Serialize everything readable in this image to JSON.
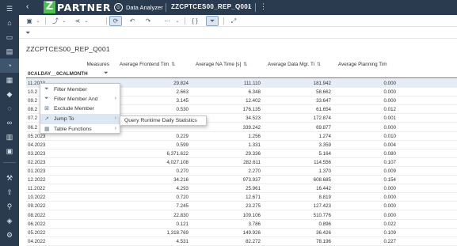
{
  "shell": {
    "logo_letter": "Z",
    "logo_text": "PARTNER",
    "app_name": "Data Analyzer",
    "document_name": "ZZCPTCES00_REP_Q001"
  },
  "query_title": "ZZCPTCES00_REP_Q001",
  "table": {
    "measures_label": "Measures",
    "dimension_label": "0CALDAY__0CALMONTH",
    "columns": [
      "Average Frontend Tim",
      "Average NA Time [s]",
      "Average Data Mgr. Ti",
      "Average Planning Tim"
    ],
    "rows": [
      {
        "label": "11.2023",
        "values": [
          "29.824",
          "111.110",
          "181.942",
          "0.000"
        ]
      },
      {
        "label": "10.2",
        "values": [
          "2.663",
          "6.348",
          "58.662",
          "0.000"
        ]
      },
      {
        "label": "09.2",
        "values": [
          "3.145",
          "12.402",
          "33.647",
          "0.000"
        ]
      },
      {
        "label": "08.2",
        "values": [
          "0.530",
          "176.135",
          "61.654",
          "0.012"
        ]
      },
      {
        "label": "07.2",
        "values": [
          "",
          "34.523",
          "172.874",
          "0.001"
        ]
      },
      {
        "label": "06.2",
        "values": [
          "",
          "339.242",
          "69.877",
          "0.000"
        ]
      },
      {
        "label": "05.2023",
        "values": [
          "0.229",
          "1.256",
          "1.274",
          "0.010"
        ]
      },
      {
        "label": "04.2023",
        "values": [
          "0.599",
          "1.331",
          "3.359",
          "0.004"
        ]
      },
      {
        "label": "03.2023",
        "values": [
          "6,371.622",
          "29.336",
          "5.164",
          "0.080"
        ]
      },
      {
        "label": "02.2023",
        "values": [
          "4,027.108",
          "282.611",
          "114.556",
          "0.107"
        ]
      },
      {
        "label": "01.2023",
        "values": [
          "0.270",
          "2.270",
          "1.370",
          "0.009"
        ]
      },
      {
        "label": "12.2022",
        "values": [
          "34.216",
          "973.937",
          "608.685",
          "0.154"
        ]
      },
      {
        "label": "11.2022",
        "values": [
          "4.293",
          "25.961",
          "16.442",
          "0.000"
        ]
      },
      {
        "label": "10.2022",
        "values": [
          "0.720",
          "12.671",
          "8.819",
          "0.000"
        ]
      },
      {
        "label": "09.2022",
        "values": [
          "7.245",
          "23.275",
          "127.423",
          "0.000"
        ]
      },
      {
        "label": "08.2022",
        "values": [
          "22.830",
          "109.106",
          "510.776",
          "0.000"
        ]
      },
      {
        "label": "06.2022",
        "values": [
          "0.121",
          "3.786",
          "0.896",
          "0.022"
        ]
      },
      {
        "label": "05.2022",
        "values": [
          "1,318.769",
          "149.926",
          "36.426",
          "0.109"
        ]
      },
      {
        "label": "04.2022",
        "values": [
          "4.531",
          "82.272",
          "78.196",
          "0.227"
        ]
      }
    ]
  },
  "context_menu": {
    "items": [
      {
        "label": "Filter Member",
        "icon": "filter-icon",
        "has_submenu": false
      },
      {
        "label": "Filter Member And",
        "icon": "filter-icon",
        "has_submenu": true
      },
      {
        "label": "Exclude Member",
        "icon": "exclude-icon",
        "has_submenu": false
      },
      {
        "label": "Jump To",
        "icon": "jump-to-icon",
        "has_submenu": true
      },
      {
        "label": "Table Functions",
        "icon": "table-icon",
        "has_submenu": true
      }
    ],
    "submenu": {
      "label": "Query Runtime Daily Statistics"
    }
  },
  "colors": {
    "shell_bg": "#2a3b4f",
    "logo_green": "#49c24b",
    "menu_hover": "#dde7f2"
  }
}
